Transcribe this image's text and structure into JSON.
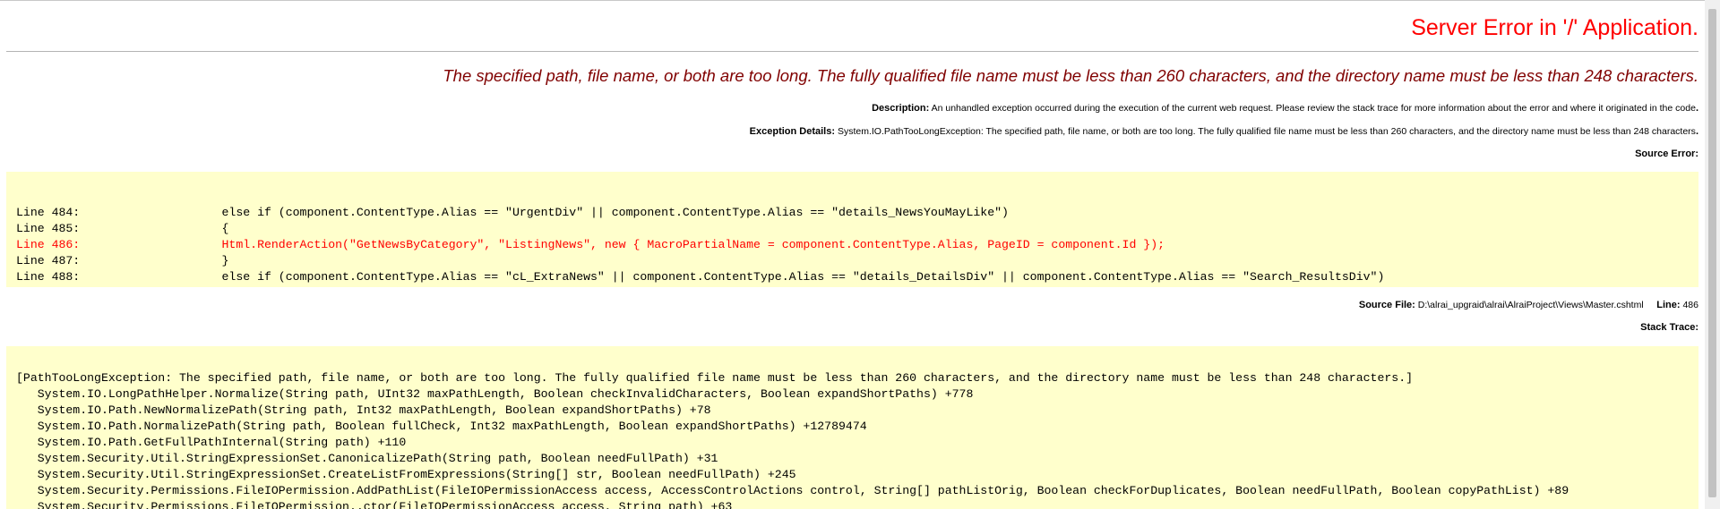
{
  "page": {
    "title": ".Server Error in '/' Application",
    "error_message": ".The specified path, file name, or both are too long. The fully qualified file name must be less than 260 characters, and the directory name must be less than 248 characters",
    "description_label": ".Description:",
    "description_text": "An unhandled exception occurred during the execution of the current web request. Please review the stack trace for more information about the error and where it originated in the code",
    "exception_label": ".Exception Details:",
    "exception_text": "System.IO.PathTooLongException: The specified path, file name, or both are too long. The fully qualified file name must be less than 260 characters, and the directory name must be less than 248 characters",
    "source_error_label": ":Source Error",
    "source_lines": [
      "Line 484:                    else if (component.ContentType.Alias == \"UrgentDiv\" || component.ContentType.Alias == \"details_NewsYouMayLike\")",
      "Line 485:                    {",
      "Line 486:                    Html.RenderAction(\"GetNewsByCategory\", \"ListingNews\", new { MacroPartialName = component.ContentType.Alias, PageID = component.Id });",
      "Line 487:                    }",
      "Line 488:                    else if (component.ContentType.Alias == \"cL_ExtraNews\" || component.ContentType.Alias == \"details_DetailsDiv\" || component.ContentType.Alias == \"Search_ResultsDiv\")"
    ],
    "source_file_label": "Source File:",
    "source_file_value": "D:\\alrai_upgraid\\alrai\\AlraiProject\\Views\\Master.cshtml",
    "line_label": "Line:",
    "line_value": "486",
    "stack_trace_label": ":Stack Trace",
    "stack_lines": [
      "[PathTooLongException: The specified path, file name, or both are too long. The fully qualified file name must be less than 260 characters, and the directory name must be less than 248 characters.]",
      "   System.IO.LongPathHelper.Normalize(String path, UInt32 maxPathLength, Boolean checkInvalidCharacters, Boolean expandShortPaths) +778",
      "   System.IO.Path.NewNormalizePath(String path, Int32 maxPathLength, Boolean expandShortPaths) +78",
      "   System.IO.Path.NormalizePath(String path, Boolean fullCheck, Int32 maxPathLength, Boolean expandShortPaths) +12789474",
      "   System.IO.Path.GetFullPathInternal(String path) +110",
      "   System.Security.Util.StringExpressionSet.CanonicalizePath(String path, Boolean needFullPath) +31",
      "   System.Security.Util.StringExpressionSet.CreateListFromExpressions(String[] str, Boolean needFullPath) +245",
      "   System.Security.Permissions.FileIOPermission.AddPathList(FileIOPermissionAccess access, AccessControlActions control, String[] pathListOrig, Boolean checkForDuplicates, Boolean needFullPath, Boolean copyPathList) +89",
      "   System.Security.Permissions.FileIOPermission..ctor(FileIOPermissionAccess access, String path) +63"
    ]
  },
  "colors": {
    "title": "#ff0000",
    "error_message": "#800000",
    "highlight_line": "#ff0000",
    "code_background": "#ffffcc"
  }
}
